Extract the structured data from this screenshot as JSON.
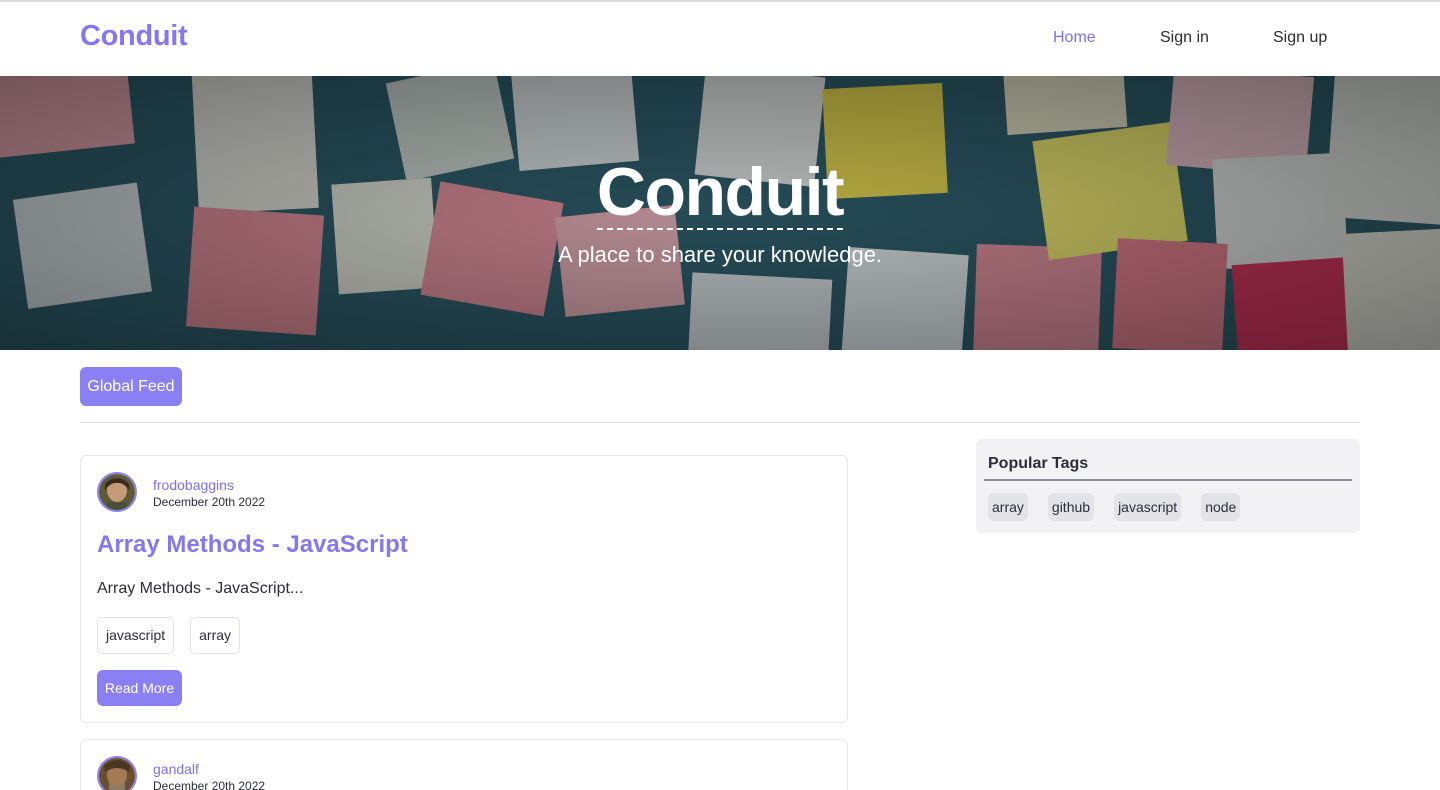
{
  "navbar": {
    "brand": "Conduit",
    "links": [
      {
        "label": "Home",
        "active": true
      },
      {
        "label": "Sign in",
        "active": false
      },
      {
        "label": "Sign up",
        "active": false
      }
    ]
  },
  "hero": {
    "title": "Conduit",
    "subtitle": "A place to share your knowledge."
  },
  "feed": {
    "tab_label": "Global Feed"
  },
  "articles": [
    {
      "author": "frodobaggins",
      "date": "December 20th 2022",
      "title": "Array Methods - JavaScript",
      "description": "Array Methods - JavaScript...",
      "tags": [
        "javascript",
        "array"
      ],
      "read_more": "Read More"
    },
    {
      "author": "gandalf",
      "date": "December 20th 2022"
    }
  ],
  "sidebar": {
    "title": "Popular Tags",
    "tags": [
      "array",
      "github",
      "javascript",
      "node"
    ]
  },
  "colors": {
    "accent": "#8b7ff4",
    "brand": "#8577f2"
  }
}
